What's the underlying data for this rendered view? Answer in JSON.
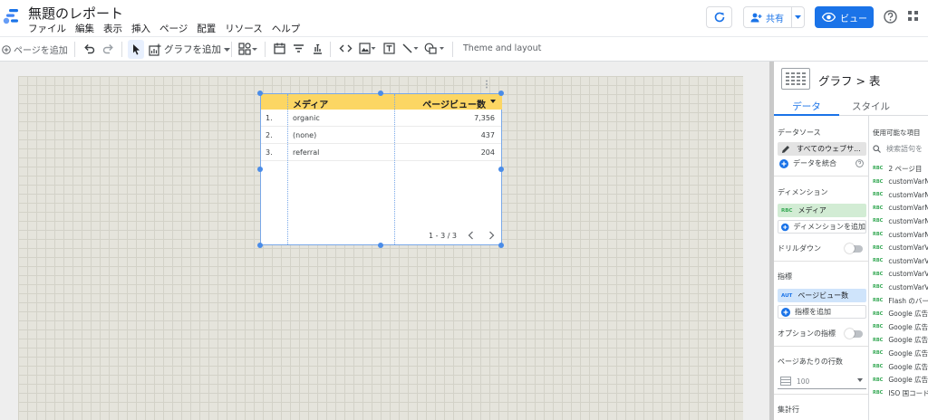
{
  "app": {
    "doc_title": "無題のレポート",
    "menu": [
      "ファイル",
      "編集",
      "表示",
      "挿入",
      "ページ",
      "配置",
      "リソース",
      "ヘルプ"
    ],
    "share_label": "共有",
    "view_label": "ビュー",
    "accent_color": "#1a73e8"
  },
  "toolbar": {
    "add_page_label": "ページを追加",
    "add_chart_label": "グラフを追加",
    "theme_label": "Theme and layout",
    "icons": [
      "undo-icon",
      "redo-icon",
      "select-icon",
      "add-chart-icon",
      "controls-icon",
      "date-range-icon",
      "filter-control-icon",
      "data-control-icon",
      "url-embed-icon",
      "image-icon",
      "text-icon",
      "line-icon",
      "shape-icon"
    ]
  },
  "table": {
    "headers": {
      "dimension": "メディア",
      "metric": "ページビュー数"
    },
    "rows": [
      {
        "idx": "1.",
        "dim": "organic",
        "met": "7,356"
      },
      {
        "idx": "2.",
        "dim": "(none)",
        "met": "437"
      },
      {
        "idx": "3.",
        "dim": "referral",
        "met": "204"
      }
    ],
    "pagination": "1 - 3 / 3",
    "header_color": "#fcd663"
  },
  "panel": {
    "breadcrumb": "グラフ > 表",
    "tabs": {
      "data": "データ",
      "style": "スタイル"
    },
    "data_source_label": "データソース",
    "data_source_value": "すべてのウェブサ...",
    "blend_label": "データを統合",
    "dimension_label": "ディメンション",
    "dimension_tag": "RBC",
    "dimension_value": "メディア",
    "add_dimension": "ディメンションを追加",
    "drilldown_label": "ドリルダウン",
    "metric_label": "指標",
    "metric_tag": "AUT",
    "metric_value": "ページビュー数",
    "add_metric": "指標を追加",
    "optional_metrics_label": "オプションの指標",
    "rows_per_page_label": "ページあたりの行数",
    "rows_per_page_value": "100",
    "aggregate_label": "集計行",
    "fields_title": "使用可能な項目",
    "search_placeholder": "検索語句を",
    "field_tag": "RBC",
    "fields": [
      "2 ページ目",
      "customVarN",
      "customVarN",
      "customVarN",
      "customVarN",
      "customVarN",
      "customVarV",
      "customVarV",
      "customVarV",
      "customVarV",
      "Flash のバー",
      "Google 広告",
      "Google 広告",
      "Google 広告",
      "Google 広告",
      "Google 広告",
      "Google 広告",
      "ISO 国コード"
    ]
  }
}
